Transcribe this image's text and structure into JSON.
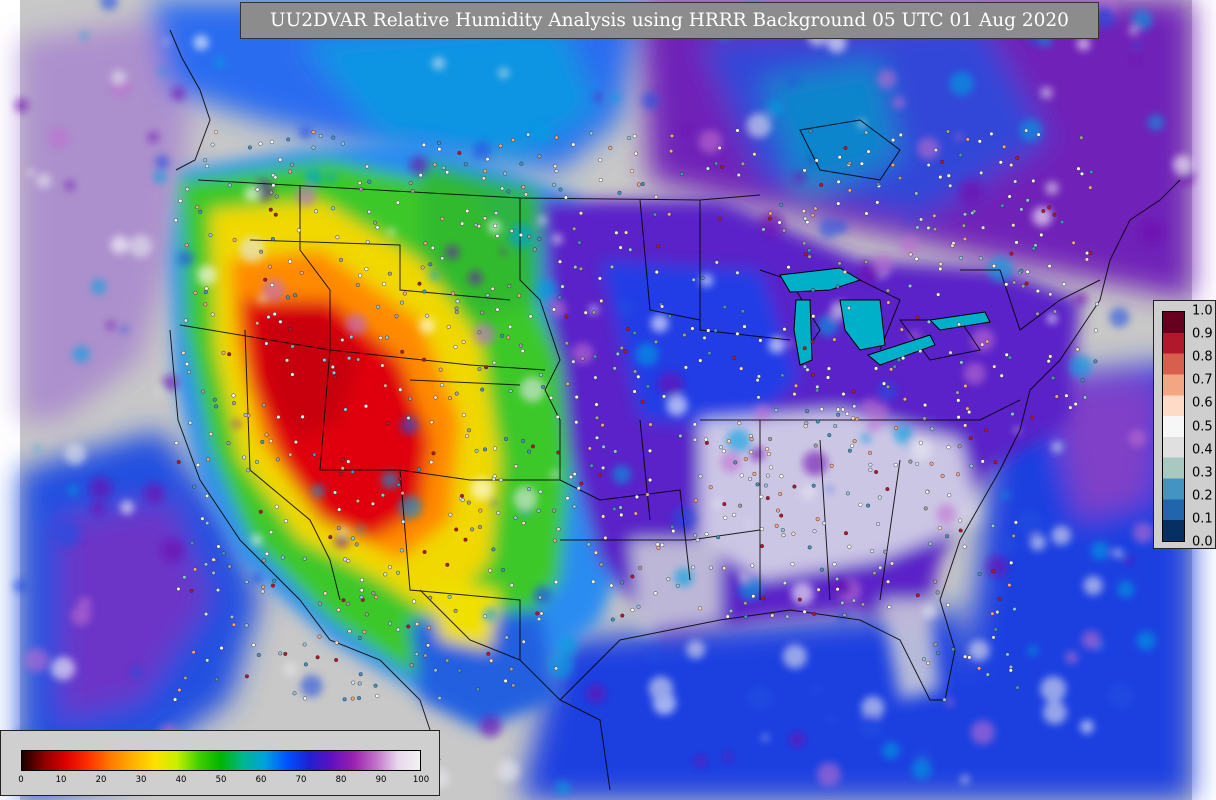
{
  "title": "UU2DVAR Relative Humidity Analysis using HRRR Background 05 UTC 01 Aug 2020",
  "rh_colorbar": {
    "ticks": [
      "0",
      "10",
      "20",
      "30",
      "40",
      "50",
      "60",
      "70",
      "80",
      "90",
      "100"
    ],
    "stops": [
      "#1a0000",
      "#8b0000",
      "#e00000",
      "#ff3000",
      "#ff7a00",
      "#ffb000",
      "#ffe000",
      "#c8f000",
      "#40d000",
      "#00b400",
      "#00b890",
      "#00a0e0",
      "#0050ff",
      "#2020d0",
      "#6010c0",
      "#9a20b0",
      "#c070c8",
      "#e8d8ec",
      "#f2f2f2"
    ]
  },
  "qc_colorbar": {
    "ticks": [
      "1.0",
      "0.9",
      "0.8",
      "0.7",
      "0.6",
      "0.5",
      "0.4",
      "0.3",
      "0.2",
      "0.1",
      "0.0"
    ],
    "stops": [
      "#67001f",
      "#b2182b",
      "#d6604d",
      "#f4a582",
      "#fddbc7",
      "#f7f7f7",
      "#e0e0e0",
      "#a8c8c0",
      "#4393c3",
      "#2166ac",
      "#053061"
    ]
  },
  "colors": {
    "ocean_gray": "#c8c8c8",
    "ocean_blue": "#1a3fe0",
    "purple": "#7a10b0",
    "green": "#30c020",
    "red": "#e01010",
    "orange": "#ff8a00",
    "yellow": "#f0e000",
    "cyan": "#00b0d0"
  }
}
